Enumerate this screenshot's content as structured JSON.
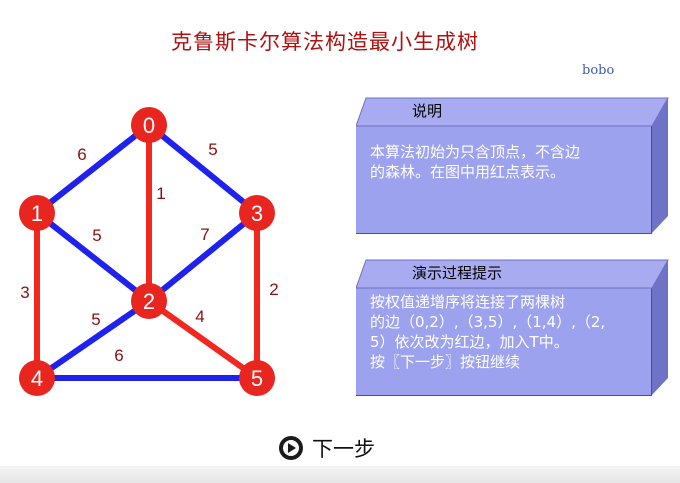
{
  "title": "克鲁斯卡尔算法构造最小生成树",
  "author": "bobo",
  "graph": {
    "nodes": [
      {
        "id": "0",
        "color": "#e8251e"
      },
      {
        "id": "1",
        "color": "#e8251e"
      },
      {
        "id": "2",
        "color": "#e8251e"
      },
      {
        "id": "3",
        "color": "#e8251e"
      },
      {
        "id": "4",
        "color": "#e8251e"
      },
      {
        "id": "5",
        "color": "#e8251e"
      }
    ],
    "edges": [
      {
        "from": "0",
        "to": "1",
        "weight": "6",
        "color": "blue"
      },
      {
        "from": "0",
        "to": "3",
        "weight": "5",
        "color": "blue"
      },
      {
        "from": "0",
        "to": "2",
        "weight": "1",
        "color": "red"
      },
      {
        "from": "1",
        "to": "2",
        "weight": "5",
        "color": "blue"
      },
      {
        "from": "3",
        "to": "2",
        "weight": "7",
        "color": "blue"
      },
      {
        "from": "1",
        "to": "4",
        "weight": "3",
        "color": "red"
      },
      {
        "from": "3",
        "to": "5",
        "weight": "2",
        "color": "red"
      },
      {
        "from": "2",
        "to": "4",
        "weight": "5",
        "color": "blue"
      },
      {
        "from": "2",
        "to": "5",
        "weight": "4",
        "color": "red"
      },
      {
        "from": "4",
        "to": "5",
        "weight": "6",
        "color": "blue"
      }
    ],
    "colors": {
      "red_edge": "#f0281f",
      "blue_edge": "#1f22ee",
      "node": "#e8251e"
    }
  },
  "panels": {
    "explain": {
      "title": "说明",
      "lines": [
        "本算法初始为只含顶点，不含边",
        "的森林。在图中用红点表示。"
      ]
    },
    "hint": {
      "title": "演示过程提示",
      "lines": [
        "按权值递增序将连接了两棵树",
        "的边（0,2）,（3,5）,（1,4）,（2,",
        "5）依次改为红边，加入T中。",
        "按〖下一步〗按钮继续"
      ]
    }
  },
  "next_button": {
    "label": "下一步",
    "icon": "play-circle-icon"
  }
}
